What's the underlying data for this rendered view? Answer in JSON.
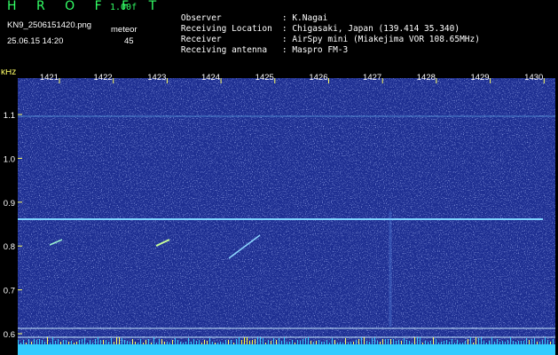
{
  "header": {
    "app_title": "H R O F F T",
    "version": "1.00f",
    "filename": "KN9_2506151420.png",
    "mode": "meteor",
    "datetime": "25.06.15 14:20",
    "count": "45",
    "info": [
      {
        "label": "Observer",
        "value": ": K.Nagai"
      },
      {
        "label": "Receiving Location",
        "value": ": Chigasaki, Japan (139.414 35.340)"
      },
      {
        "label": "Receiver",
        "value": ": AirSpy mini (Miakejima VOR 108.65MHz)"
      },
      {
        "label": "Receiving antenna",
        "value": ": Maspro FM-3"
      }
    ]
  },
  "spectrogram": {
    "unit_label": "kHz",
    "time_ticks": [
      "1421",
      "1422",
      "1423",
      "1424",
      "1425",
      "1426",
      "1427",
      "1428",
      "1429",
      "1430"
    ],
    "freq_ticks": [
      "1.1",
      "1.0",
      "0.9",
      "0.8",
      "0.7",
      "0.6"
    ],
    "colors": {
      "background": "#1a2a8a",
      "tick": "#ffff66",
      "line": "#7fd4ff",
      "floor": "#33ccff"
    }
  }
}
